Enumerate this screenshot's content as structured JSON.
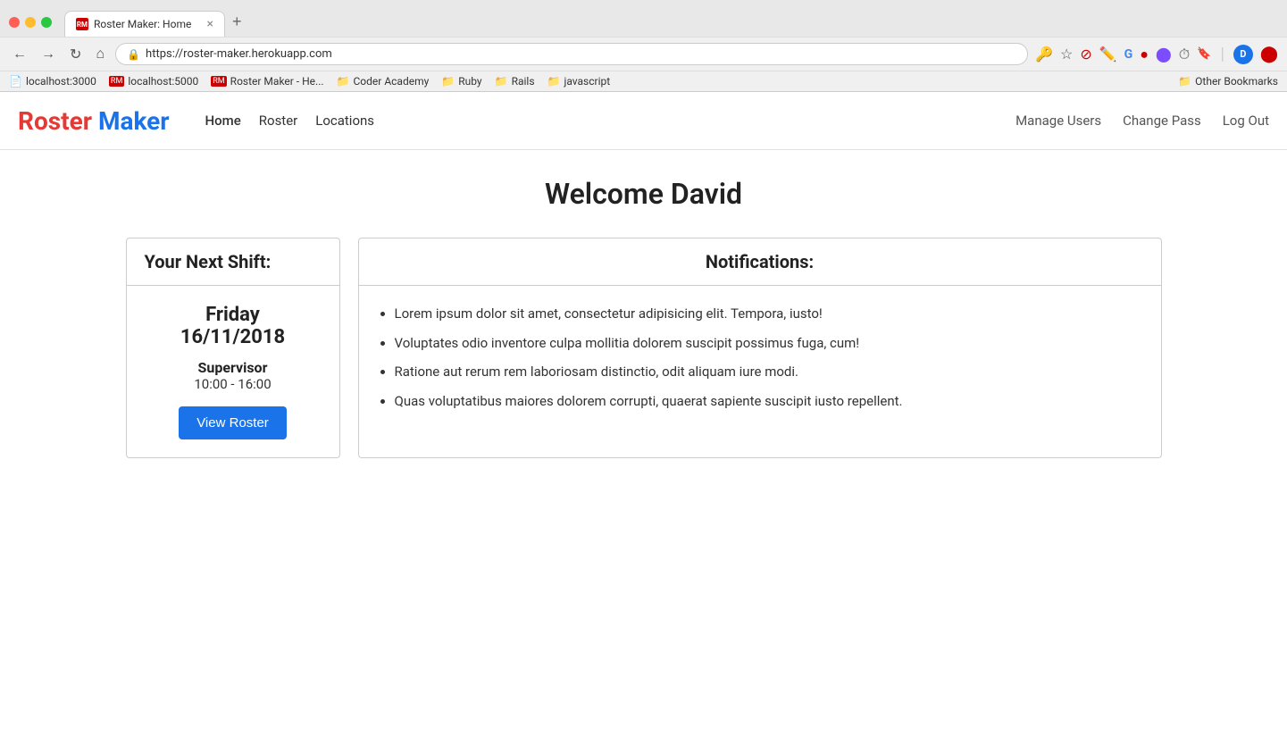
{
  "browser": {
    "tab": {
      "favicon_text": "RM",
      "title": "Roster Maker: Home",
      "close_label": "×"
    },
    "new_tab_label": "+",
    "nav": {
      "back_label": "←",
      "forward_label": "→",
      "reload_label": "↻",
      "home_label": "⌂"
    },
    "address": "https://roster-maker.herokuapp.com",
    "toolbar_icons": [
      "🔑",
      "★",
      "🛑",
      "✏️",
      "G",
      "◎",
      "🟣",
      "⏱",
      "🔖",
      "D",
      "🔴"
    ],
    "bookmarks": [
      {
        "label": "localhost:3000"
      },
      {
        "label": "localhost:5000",
        "favicon": "RM"
      },
      {
        "label": "Roster Maker - He...",
        "favicon": "RM"
      },
      {
        "label": "Coder Academy"
      },
      {
        "label": "Ruby"
      },
      {
        "label": "Rails"
      },
      {
        "label": "javascript"
      }
    ],
    "other_bookmarks_label": "Other Bookmarks"
  },
  "nav": {
    "brand_roster": "Roster",
    "brand_maker": " Maker",
    "links": [
      {
        "label": "Home",
        "active": true
      },
      {
        "label": "Roster",
        "active": false
      },
      {
        "label": "Locations",
        "active": false
      }
    ],
    "right_links": [
      {
        "label": "Manage Users"
      },
      {
        "label": "Change Pass"
      },
      {
        "label": "Log Out"
      }
    ]
  },
  "main": {
    "welcome_title": "Welcome David",
    "shift_card": {
      "header": "Your Next Shift:",
      "day": "Friday",
      "date": "16/11/2018",
      "role": "Supervisor",
      "time": "10:00 - 16:00",
      "button_label": "View Roster"
    },
    "notifications_card": {
      "header": "Notifications:",
      "items": [
        "Lorem ipsum dolor sit amet, consectetur adipisicing elit. Tempora, iusto!",
        "Voluptates odio inventore culpa mollitia dolorem suscipit possimus fuga, cum!",
        "Ratione aut rerum rem laboriosam distinctio, odit aliquam iure modi.",
        "Quas voluptatibus maiores dolorem corrupti, quaerat sapiente suscipit iusto repellent."
      ]
    }
  }
}
